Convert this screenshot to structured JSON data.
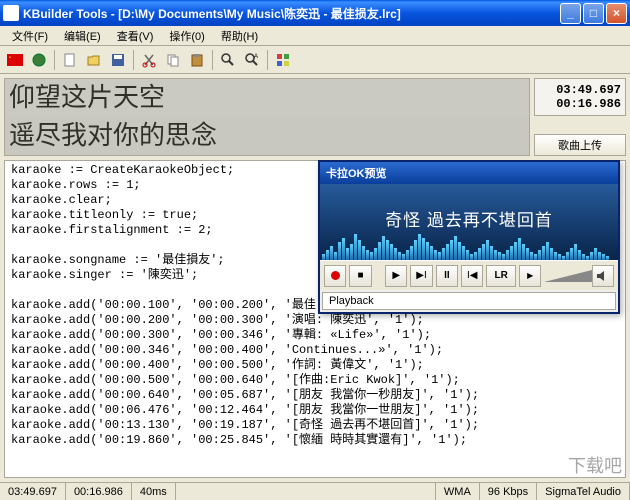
{
  "window": {
    "title": "KBuilder Tools - [D:\\My Documents\\My Music\\陈奕迅 - 最佳损友.lrc]"
  },
  "menu": {
    "file": "文件(F)",
    "edit": "编辑(E)",
    "view": "查看(V)",
    "action": "操作(0)",
    "help": "帮助(H)"
  },
  "time": {
    "total": "03:49.697",
    "current": "00:16.986"
  },
  "lyrics": {
    "line1": "仰望这片天空",
    "line2": "遥尽我对你的思念"
  },
  "upload": {
    "label": "歌曲上传"
  },
  "script_lines": [
    "karaoke := CreateKaraokeObject;",
    "karaoke.rows := 1;",
    "karaoke.clear;",
    "karaoke.titleonly := true;",
    "karaoke.firstalignment := 2;",
    "",
    "karaoke.songname := '最佳損友';",
    "karaoke.singer := '陳奕迅';",
    "",
    "karaoke.add('00:00.100', '00:00.200', '最佳",
    "karaoke.add('00:00.200', '00:00.300', '演唱: 陳奕迅', '1');",
    "karaoke.add('00:00.300', '00:00.346', '專輯: «Life»', '1');",
    "karaoke.add('00:00.346', '00:00.400', 'Continues...»', '1');",
    "karaoke.add('00:00.400', '00:00.500', '作詞: 黃偉文', '1');",
    "karaoke.add('00:00.500', '00:00.640', '[作曲:Eric Kwok]', '1');",
    "karaoke.add('00:00.640', '00:05.687', '[朋友 我當你一秒朋友]', '1');",
    "karaoke.add('00:06.476', '00:12.464', '[朋友 我當你一世朋友]', '1');",
    "karaoke.add('00:13.130', '00:19.187', '[奇怪 過去再不堪回首]', '1');",
    "karaoke.add('00:19.860', '00:25.845', '[懷緬 時時其實還有]', '1');"
  ],
  "preview": {
    "title": "卡拉OK预览",
    "lyric": "奇怪  過去再不堪回首",
    "playback": "Playback",
    "lr": "LR"
  },
  "statusbar": {
    "t1": "03:49.697",
    "t2": "00:16.986",
    "latency": "40ms",
    "codec": "WMA",
    "bitrate": "96 Kbps",
    "audio": "SigmaTel Audio"
  },
  "watermark": "下载吧"
}
